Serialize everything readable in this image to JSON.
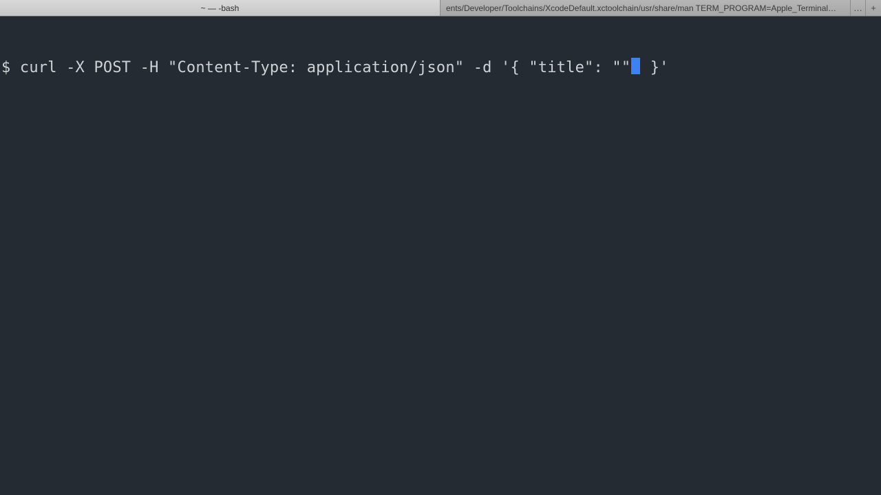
{
  "tabs": {
    "active_label": "~ — -bash",
    "inactive_label": "…ents/Developer/Toolchains/XcodeDefault.xctoolchain/usr/share/man TERM_PROGRAM=Apple_Terminal",
    "overflow_glyph": "…",
    "newtab_glyph": "+"
  },
  "terminal": {
    "prompt": "$ ",
    "command_before_cursor": "curl -X POST -H \"Content-Type: application/json\" -d '{ \"title\": \"\"",
    "command_after_cursor": " }'"
  },
  "colors": {
    "background": "#252b33",
    "foreground": "#cfd2d4",
    "cursor": "#3c82f0"
  }
}
